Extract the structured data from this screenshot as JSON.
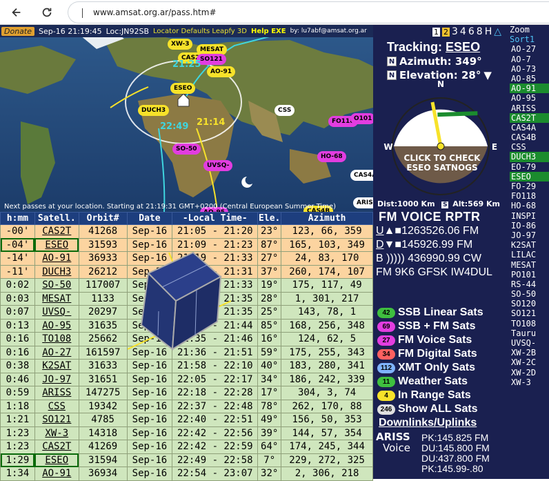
{
  "browser": {
    "url": "www.amsat.org.ar/pass.htm#"
  },
  "topbar": {
    "donate": "Donate",
    "datetime": "Sep-16 21:19:45",
    "locator": "Loc:JN92SB",
    "links": "Locator Defaults Leapfy 3D",
    "help": "Help EXE",
    "by": "by: lu7abf@amsat.org.ar"
  },
  "map": {
    "note": "Next passes at your location. Starting at 21:19:31 GMT+0200 (Central European Summer Time)",
    "labels": [
      {
        "name": "XW-3",
        "color": "y"
      },
      {
        "name": "MESAT",
        "color": "y"
      },
      {
        "name": "CAS2T",
        "color": "y"
      },
      {
        "name": "SO121",
        "color": "m"
      },
      {
        "name": "AO-91",
        "color": "y"
      },
      {
        "name": "ESEO",
        "color": "y"
      },
      {
        "name": "DUCH3",
        "color": "y"
      },
      {
        "name": "CSS",
        "color": "w"
      },
      {
        "name": "FO118",
        "color": "m"
      },
      {
        "name": "O101",
        "color": "m"
      },
      {
        "name": "SO-50",
        "color": "m"
      },
      {
        "name": "UVSQ-",
        "color": "m"
      },
      {
        "name": "HO-68",
        "color": "m"
      },
      {
        "name": "CAS4A",
        "color": "w"
      },
      {
        "name": "ARISS",
        "color": "w"
      },
      {
        "name": "AO-95",
        "color": "m"
      },
      {
        "name": "CAS4B",
        "color": "y"
      }
    ],
    "times": [
      "21:25",
      "22:49",
      "21:14"
    ]
  },
  "table": {
    "headers": [
      "h:mm",
      "Satell.",
      "Orbit#",
      "Date",
      "-Local Time-",
      "Ele.",
      "Azimuth"
    ],
    "rows": [
      {
        "h": "-00'",
        "sat": "CAS2T",
        "orbit": "41268",
        "date": "Sep-16",
        "time": "21:05 - 21:20",
        "ele": "23°",
        "az": "123, 66, 359",
        "cls": "orange",
        "boxed": false
      },
      {
        "h": "-04'",
        "sat": "ESEO",
        "orbit": "31593",
        "date": "Sep-16",
        "time": "21:09 - 21:23",
        "ele": "87°",
        "az": "165, 103, 349",
        "cls": "orange",
        "boxed": true
      },
      {
        "h": "-14'",
        "sat": "AO-91",
        "orbit": "36933",
        "date": "Sep-16",
        "time": "21:19 - 21:33",
        "ele": "27°",
        "az": "24, 83, 170",
        "cls": "orange",
        "boxed": false
      },
      {
        "h": "-11'",
        "sat": "DUCH3",
        "orbit": "26212",
        "date": "Sep-16",
        "time": "21:16 - 21:31",
        "ele": "37°",
        "az": "260, 174, 107",
        "cls": "orange",
        "boxed": false
      },
      {
        "h": "0:02",
        "sat": "SO-50",
        "orbit": "117007",
        "date": "Sep-16",
        "time": "21:21 - 21:33",
        "ele": "19°",
        "az": "175, 117, 49",
        "cls": "green",
        "boxed": false
      },
      {
        "h": "0:03",
        "sat": "MESAT",
        "orbit": "1133",
        "date": "Sep-16",
        "time": "21:22 - 21:35",
        "ele": "28°",
        "az": "1, 301, 217",
        "cls": "green",
        "boxed": false
      },
      {
        "h": "0:07",
        "sat": "UVSQ-",
        "orbit": "20297",
        "date": "Sep-16",
        "time": "21:26 - 21:35",
        "ele": "25°",
        "az": "143, 78, 1",
        "cls": "green",
        "boxed": false
      },
      {
        "h": "0:13",
        "sat": "AO-95",
        "orbit": "31635",
        "date": "Sep-16",
        "time": "21:32 - 21:44",
        "ele": "85°",
        "az": "168, 256, 348",
        "cls": "green",
        "boxed": false
      },
      {
        "h": "0:16",
        "sat": "TO108",
        "orbit": "25662",
        "date": "Sep-16",
        "time": "21:35 - 21:46",
        "ele": "16°",
        "az": "124, 62, 5",
        "cls": "green",
        "boxed": false
      },
      {
        "h": "0:16",
        "sat": "AO-27",
        "orbit": "161597",
        "date": "Sep-16",
        "time": "21:36 - 21:51",
        "ele": "59°",
        "az": "175, 255, 343",
        "cls": "green",
        "boxed": false
      },
      {
        "h": "0:38",
        "sat": "K2SAT",
        "orbit": "31633",
        "date": "Sep-16",
        "time": "21:58 - 22:10",
        "ele": "40°",
        "az": "183, 280, 341",
        "cls": "green",
        "boxed": false
      },
      {
        "h": "0:46",
        "sat": "JO-97",
        "orbit": "31651",
        "date": "Sep-16",
        "time": "22:05 - 22:17",
        "ele": "34°",
        "az": "186, 242, 339",
        "cls": "green",
        "boxed": false
      },
      {
        "h": "0:59",
        "sat": "ARISS",
        "orbit": "147275",
        "date": "Sep-16",
        "time": "22:18 - 22:28",
        "ele": "17°",
        "az": "304, 3, 74",
        "cls": "green",
        "boxed": false
      },
      {
        "h": "1:18",
        "sat": "CSS",
        "orbit": "19342",
        "date": "Sep-16",
        "time": "22:37 - 22:48",
        "ele": "78°",
        "az": "262, 170, 88",
        "cls": "green",
        "boxed": false
      },
      {
        "h": "1:21",
        "sat": "SO121",
        "orbit": "4785",
        "date": "Sep-16",
        "time": "22:40 - 22:51",
        "ele": "49°",
        "az": "156, 50, 353",
        "cls": "green",
        "boxed": false
      },
      {
        "h": "1:23",
        "sat": "XW-3",
        "orbit": "14318",
        "date": "Sep-16",
        "time": "22:42 - 22:56",
        "ele": "39°",
        "az": "144, 57, 354",
        "cls": "green",
        "boxed": false
      },
      {
        "h": "1:23",
        "sat": "CAS2T",
        "orbit": "41269",
        "date": "Sep-16",
        "time": "22:42 - 22:59",
        "ele": "64°",
        "az": "174, 245, 344",
        "cls": "green",
        "boxed": false
      },
      {
        "h": "1:29",
        "sat": "ESEO",
        "orbit": "31594",
        "date": "Sep-16",
        "time": "22:49 - 22:58",
        "ele": "7°",
        "az": "229, 272, 325",
        "cls": "green",
        "boxed": true
      },
      {
        "h": "1:34",
        "sat": "AO-91",
        "orbit": "36934",
        "date": "Sep-16",
        "time": "22:54 - 23:07",
        "ele": "32°",
        "az": "2, 306, 218",
        "cls": "green",
        "boxed": false
      }
    ]
  },
  "right": {
    "tabs": [
      "1",
      "2",
      "3",
      "4",
      "6",
      "8",
      "H"
    ],
    "tracking_label": "Tracking:",
    "tracking_sat": "ESEO",
    "azimuth": "Azimuth: 349°",
    "elevation": "Elevation: 28°",
    "compass_n": "N",
    "compass_w": "W",
    "compass_e": "E",
    "compass_s": "S",
    "click_check": "CLICK TO CHECK",
    "satnogs": "ESEO SATNOGS",
    "dist": "Dist:1000 Km",
    "alt": "Alt:569 Km",
    "fm_title": "FM VOICE RPTR",
    "uplink_lbl": "U",
    "uplink": "▲■1263526.06 FM",
    "downlink_lbl": "D",
    "downlink": "▼■145926.99 FM",
    "beacon_lbl": "B",
    "beacon": "))))) 436990.99 CW",
    "fm9k6": "FM 9K6 GFSK IW4DUL",
    "categories": [
      {
        "count": "42",
        "label": "SSB Linear Sats",
        "color": "#3fbf3f"
      },
      {
        "count": "69",
        "label": "SSB + FM  Sats",
        "color": "#e23de0"
      },
      {
        "count": "27",
        "label": "FM  Voice  Sats",
        "color": "#e23de0"
      },
      {
        "count": "34",
        "label": "FM Digital Sats",
        "color": "#ff6060"
      },
      {
        "count": "112",
        "label": "XMT Only  Sats",
        "color": "#7fb3ff"
      },
      {
        "count": "11",
        "label": "Weather   Sats",
        "color": "#3fbf3f"
      },
      {
        "count": "4",
        "label": "In Range  Sats",
        "color": "#f7e22a"
      },
      {
        "count": "246",
        "label": "Show ALL  Sats",
        "color": "#e0e0e0"
      }
    ],
    "downlinks_title": "Downlinks/Uplinks",
    "ariss": "ARISS",
    "voice": "Voice",
    "pk": [
      "PK:145.825 FM",
      "DU:145.800 FM",
      "DU:437.800 FM",
      "PK:145.99-.80"
    ]
  },
  "satlist": {
    "zoom": "Zoom",
    "sort": "Sort1",
    "items": [
      "AO-27",
      "AO-7",
      "AO-73",
      "AO-85",
      "AO-91",
      "AO-95",
      "ARISS",
      "CAS2T",
      "CAS4A",
      "CAS4B",
      "CSS",
      "DUCH3",
      "EO-79",
      "ESEO",
      "FO-29",
      "FO118",
      "HO-68",
      "INSPI",
      "IO-86",
      "JO-97",
      "K2SAT",
      "LILAC",
      "MESAT",
      "PO101",
      "RS-44",
      "SO-50",
      "SO120",
      "SO121",
      "TO108",
      "Tauru",
      "UVSQ-",
      "XW-2B",
      "XW-2C",
      "XW-2D",
      "XW-3"
    ],
    "highlighted": [
      "AO-91",
      "CAS2T",
      "DUCH3",
      "ESEO"
    ]
  }
}
